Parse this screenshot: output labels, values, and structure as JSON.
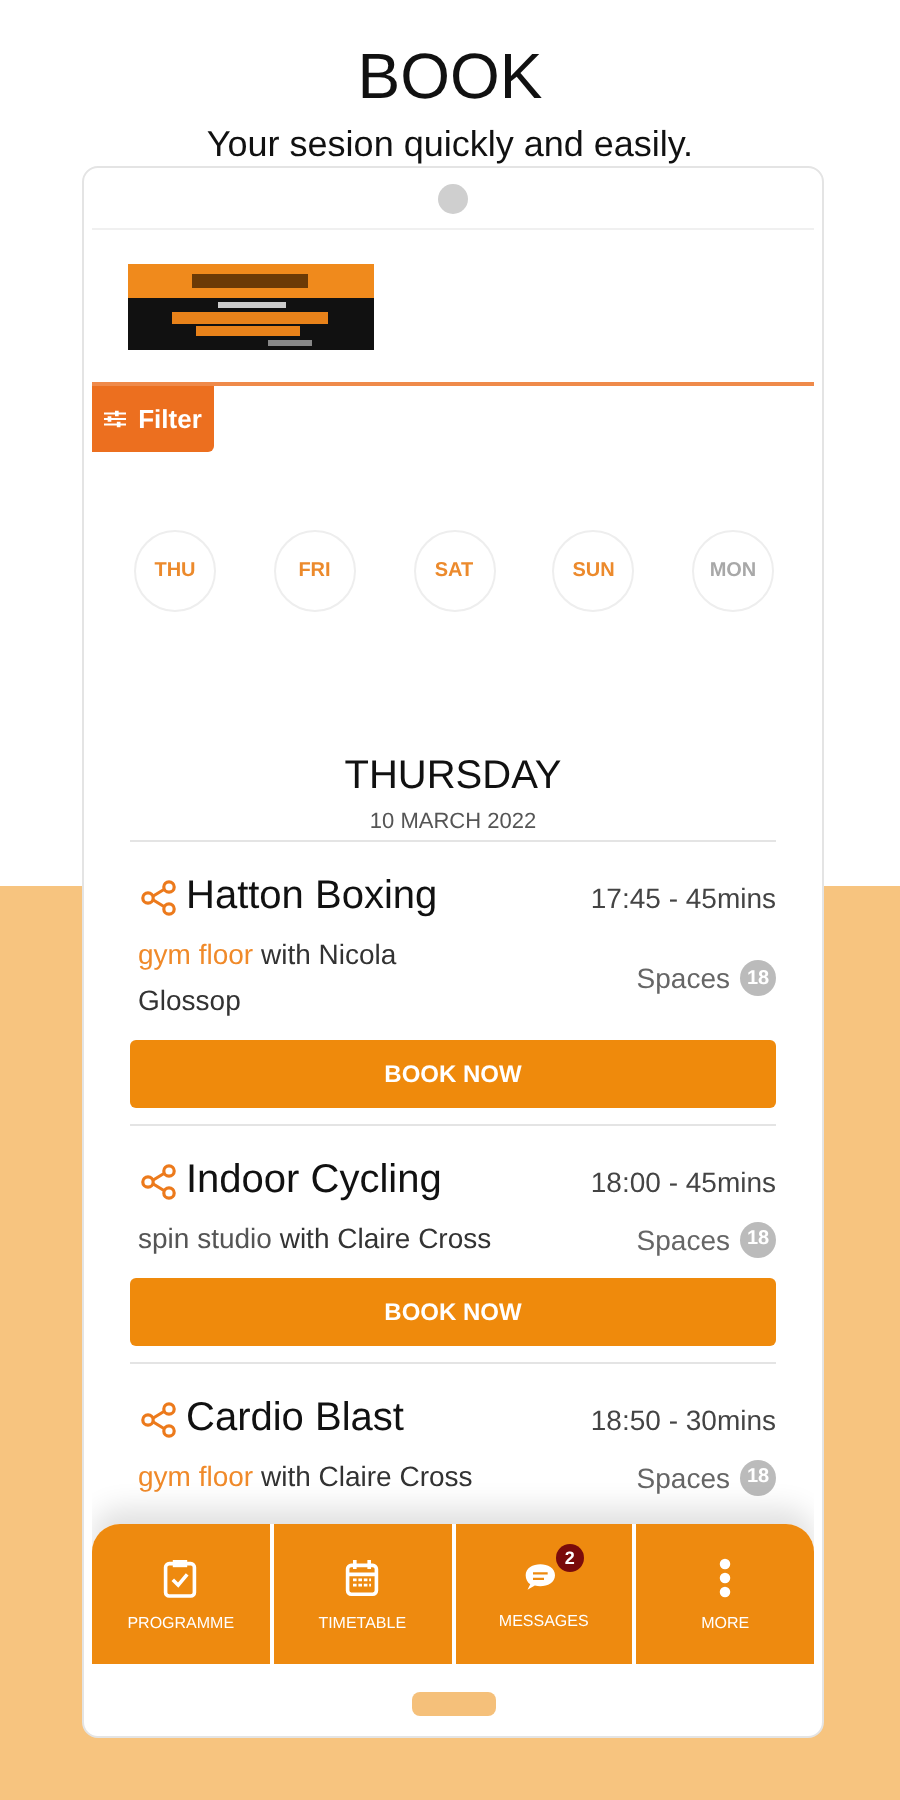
{
  "header": {
    "title": "BOOK",
    "subtitle": "Your sesion quickly and easily."
  },
  "filter": {
    "label": "Filter"
  },
  "days": [
    {
      "label": "THU",
      "disabled": false
    },
    {
      "label": "FRI",
      "disabled": false
    },
    {
      "label": "SAT",
      "disabled": false
    },
    {
      "label": "SUN",
      "disabled": false
    },
    {
      "label": "MON",
      "disabled": true
    }
  ],
  "day_heading": {
    "day": "THURSDAY",
    "date": "10 MARCH 2022"
  },
  "classes": [
    {
      "name": "Hatton Boxing",
      "time": "17:45 - 45mins",
      "location": "gym floor",
      "location_highlighted": true,
      "instructor": "with Nicola Glossop",
      "spaces_label": "Spaces",
      "spaces": "18",
      "button": "BOOK NOW"
    },
    {
      "name": "Indoor Cycling",
      "time": "18:00 - 45mins",
      "location": "spin studio",
      "location_highlighted": false,
      "instructor": "with Claire Cross",
      "spaces_label": "Spaces",
      "spaces": "18",
      "button": "BOOK NOW"
    },
    {
      "name": "Cardio Blast",
      "time": "18:50 - 30mins",
      "location": "gym floor",
      "location_highlighted": true,
      "instructor": "with Claire Cross",
      "spaces_label": "Spaces",
      "spaces": "18"
    }
  ],
  "nav": [
    {
      "kind": "programme",
      "label": "PROGRAMME"
    },
    {
      "kind": "timetable",
      "label": "TIMETABLE"
    },
    {
      "kind": "messages",
      "label": "MESSAGES",
      "badge": "2"
    },
    {
      "kind": "more",
      "label": "MORE"
    }
  ]
}
